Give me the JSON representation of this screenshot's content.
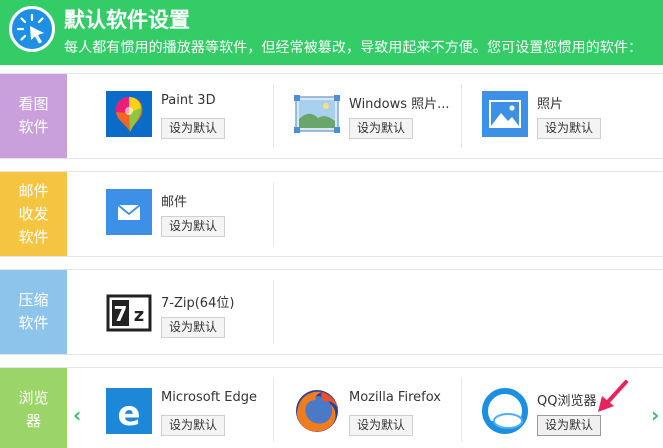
{
  "header": {
    "title": "默认软件设置",
    "description": "每人都有惯用的播放器等软件，但经常被篡改，导致用起来不方便。您可设置您惯用的软件："
  },
  "categories": [
    {
      "label": "看图软件",
      "color": "#c9a0dc",
      "apps": [
        {
          "name": "Paint 3D",
          "button": "设为默认",
          "icon": "paint-3d-icon"
        },
        {
          "name": "Windows 照片...",
          "button": "设为默认",
          "icon": "windows-photos-icon"
        },
        {
          "name": "照片",
          "button": "设为默认",
          "icon": "photos-icon"
        }
      ]
    },
    {
      "label": "邮件收发软件",
      "color": "#f5c542",
      "apps": [
        {
          "name": "邮件",
          "button": "设为默认",
          "icon": "mail-icon"
        }
      ]
    },
    {
      "label": "压缩软件",
      "color": "#8cc4ec",
      "apps": [
        {
          "name": "7-Zip(64位)",
          "button": "设为默认",
          "icon": "7zip-icon"
        }
      ]
    },
    {
      "label": "浏览器",
      "color": "#9bd56a",
      "apps": [
        {
          "name": "Microsoft Edge",
          "button": "设为默认",
          "icon": "edge-icon"
        },
        {
          "name": "Mozilla Firefox",
          "button": "设为默认",
          "icon": "firefox-icon"
        },
        {
          "name": "QQ浏览器",
          "button": "设为默认",
          "icon": "qq-browser-icon"
        }
      ]
    }
  ],
  "navigation": {
    "prev_arrow": "‹",
    "next_arrow": "›"
  },
  "colors": {
    "header_green": "#33cc66",
    "pointer_arrow": "#e8245c"
  }
}
